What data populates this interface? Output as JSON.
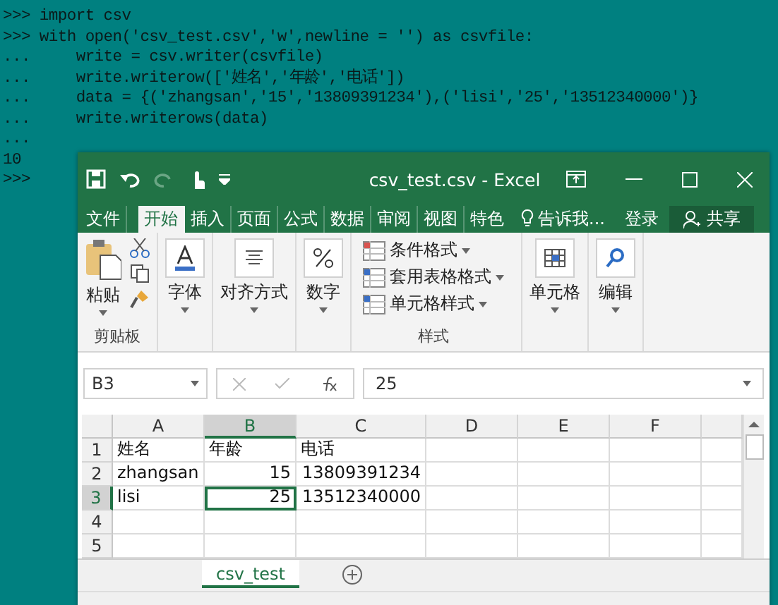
{
  "console": {
    "lines": [
      {
        "text": ">>> import csv"
      },
      {
        "text": ">>> with open('csv_test.csv','w',newline = '') as csvfile:"
      },
      {
        "text": "...     write = csv.writer(csvfile)"
      },
      {
        "text": "...     write.writerow(['姓名','年龄','电话'])"
      },
      {
        "text": "...     data = {('zhangsan','15','13809391234'),('lisi','25','13512340000')}"
      },
      {
        "text": "...     write.writerows(data)"
      },
      {
        "text": "..."
      },
      {
        "text": "10"
      },
      {
        "text": ">>>"
      }
    ]
  },
  "excel": {
    "title": "csv_test.csv - Excel",
    "tabs": [
      {
        "label": "文件",
        "selected": false
      },
      {
        "label": "开始",
        "selected": true
      },
      {
        "label": "插入",
        "selected": false
      },
      {
        "label": "页面",
        "selected": false
      },
      {
        "label": "公式",
        "selected": false
      },
      {
        "label": "数据",
        "selected": false
      },
      {
        "label": "审阅",
        "selected": false
      },
      {
        "label": "视图",
        "selected": false
      },
      {
        "label": "特色",
        "selected": false
      }
    ],
    "tell_me": "告诉我...",
    "sign_in": "登录",
    "share": "共享",
    "ribbon": {
      "clipboard": {
        "paste": "粘贴",
        "label": "剪贴板"
      },
      "groups": [
        {
          "kind": "font",
          "label": "字体"
        },
        {
          "kind": "align",
          "label": "对齐方式"
        },
        {
          "kind": "number",
          "label": "数字"
        }
      ],
      "styles": {
        "items": [
          "条件格式",
          "套用表格格式",
          "单元格样式"
        ],
        "label": "样式"
      },
      "tail": [
        {
          "kind": "cells",
          "label": "单元格"
        },
        {
          "kind": "edit",
          "label": "编辑"
        }
      ]
    },
    "formula_bar": {
      "name_box": "B3",
      "value": "25"
    },
    "columns": [
      {
        "label": "A",
        "selected": false
      },
      {
        "label": "B",
        "selected": true
      },
      {
        "label": "C",
        "selected": false
      },
      {
        "label": "D",
        "selected": false
      },
      {
        "label": "E",
        "selected": false
      },
      {
        "label": "F",
        "selected": false
      }
    ],
    "rows": [
      {
        "header": "1",
        "selected": false,
        "cells": [
          {
            "text": "姓名",
            "kind": "text",
            "selected": false
          },
          {
            "text": "年龄",
            "kind": "text",
            "selected": false
          },
          {
            "text": "电话",
            "kind": "text",
            "selected": false
          }
        ]
      },
      {
        "header": "2",
        "selected": false,
        "cells": [
          {
            "text": "zhangsan",
            "kind": "text",
            "selected": false
          },
          {
            "text": "15",
            "kind": "number",
            "selected": false
          },
          {
            "text": "13809391234",
            "kind": "number",
            "selected": false
          }
        ]
      },
      {
        "header": "3",
        "selected": true,
        "cells": [
          {
            "text": "lisi",
            "kind": "text",
            "selected": false
          },
          {
            "text": "25",
            "kind": "number",
            "selected": true
          },
          {
            "text": "13512340000",
            "kind": "number",
            "selected": false
          }
        ]
      },
      {
        "header": "4",
        "selected": false,
        "cells": []
      },
      {
        "header": "5",
        "selected": false,
        "cells": []
      }
    ],
    "sheets": [
      {
        "label": "csv_test",
        "selected": true
      }
    ]
  }
}
